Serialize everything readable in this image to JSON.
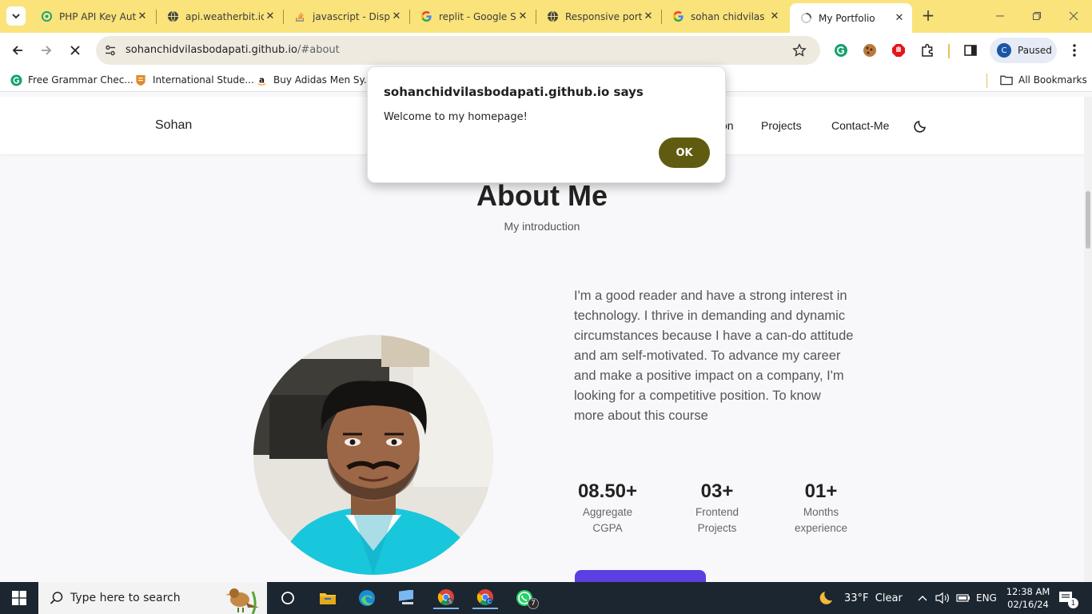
{
  "browser": {
    "tabs": [
      {
        "title": "PHP API Key Aut",
        "icon": "openai-icon"
      },
      {
        "title": "api.weatherbit.io",
        "icon": "globe-icon"
      },
      {
        "title": "javascript - Disp",
        "icon": "stackoverflow-icon"
      },
      {
        "title": "replit - Google S",
        "icon": "google-icon"
      },
      {
        "title": "Responsive portf",
        "icon": "globe-icon"
      },
      {
        "title": "sohan chidvilas",
        "icon": "google-icon"
      },
      {
        "title": "My Portfolio",
        "icon": "loading-icon",
        "active": true
      }
    ],
    "url_host": "sohanchidvilasbodapati.github.io",
    "url_path": "/#about",
    "profile_initial": "C",
    "profile_status": "Paused",
    "bookmarks": [
      {
        "label": "Free Grammar Chec...",
        "icon": "grammarly-icon"
      },
      {
        "label": "International Stude...",
        "icon": "university-shield-icon"
      },
      {
        "label": "Buy Adidas Men Sy...",
        "icon": "amazon-icon"
      }
    ],
    "all_bookmarks": "All Bookmarks"
  },
  "dialog": {
    "title": "sohanchidvilasbodapati.github.io says",
    "message": "Welcome to my homepage!",
    "ok_label": "OK"
  },
  "site": {
    "logo": "Sohan",
    "nav": {
      "partial": "on",
      "projects": "Projects",
      "contact": "Contact-Me"
    },
    "about": {
      "title": "About Me",
      "subtitle": "My introduction",
      "description": "I'm a good reader and have a strong interest in technology. I thrive in demanding and dynamic circumstances because I have a can-do attitude and am self-motivated. To advance my career and make a positive impact on a company, I'm looking for a competitive position. To know more about this course",
      "stats": [
        {
          "num": "08.50+",
          "line1": "Aggregate",
          "line2": "CGPA"
        },
        {
          "num": "03+",
          "line1": "Frontend",
          "line2": "Projects"
        },
        {
          "num": "01+",
          "line1": "Months",
          "line2": "experience"
        }
      ]
    }
  },
  "taskbar": {
    "search_placeholder": "Type here to search",
    "weather": "33°F  Clear",
    "language": "ENG",
    "time": "12:38 AM",
    "date": "02/16/24",
    "whatsapp_badge": "7",
    "notification_badge": "1"
  },
  "colors": {
    "tabstrip": "#f9e37a",
    "ok_button": "#5f5c11",
    "cta_button": "#5b3fe0",
    "taskbar": "#1c2630"
  }
}
